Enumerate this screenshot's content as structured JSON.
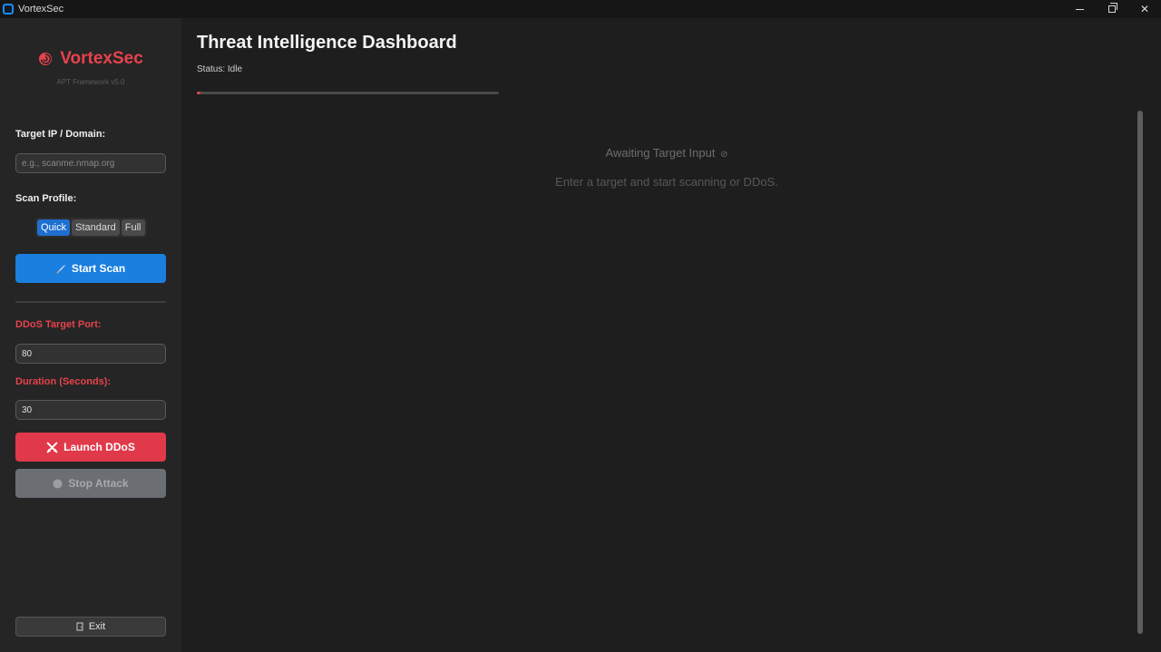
{
  "window": {
    "title": "VortexSec",
    "controls": [
      "minimize-icon",
      "restore-icon",
      "close-icon"
    ],
    "close_glyph": "✕"
  },
  "sidebar": {
    "brand_name": "VortexSec",
    "brand_icon": "swirl-icon",
    "subtitle": "APT Framework v5.0",
    "target_label": "Target IP / Domain:",
    "target_placeholder": "e.g., scanme.nmap.org",
    "target_value": "",
    "scan_profile_label": "Scan Profile:",
    "scan_profiles": [
      "Quick",
      "Standard",
      "Full"
    ],
    "scan_profile_selected": "Quick",
    "start_scan_label": "Start Scan",
    "start_scan_icon": "rocket-icon",
    "ddos_port_label": "DDoS Target Port:",
    "ddos_port_value": "80",
    "duration_label": "Duration (Seconds):",
    "duration_value": "30",
    "launch_label": "Launch DDoS",
    "launch_icon": "crossed-swords-icon",
    "stop_label": "Stop Attack",
    "stop_icon": "stop-circle-icon",
    "exit_label": "Exit",
    "exit_icon": "door-icon"
  },
  "main": {
    "title": "Threat Intelligence Dashboard",
    "status": "Status: Idle",
    "progress": 0.01,
    "empty_title": "Awaiting Target Input",
    "empty_icon": "rocket-icon",
    "empty_hint": "Enter a target and start scanning or DDoS."
  },
  "colors": {
    "accent_red": "#e5434c",
    "accent_blue": "#1a7fdf",
    "background": "#1e1e1e",
    "sidebar": "#252525"
  }
}
